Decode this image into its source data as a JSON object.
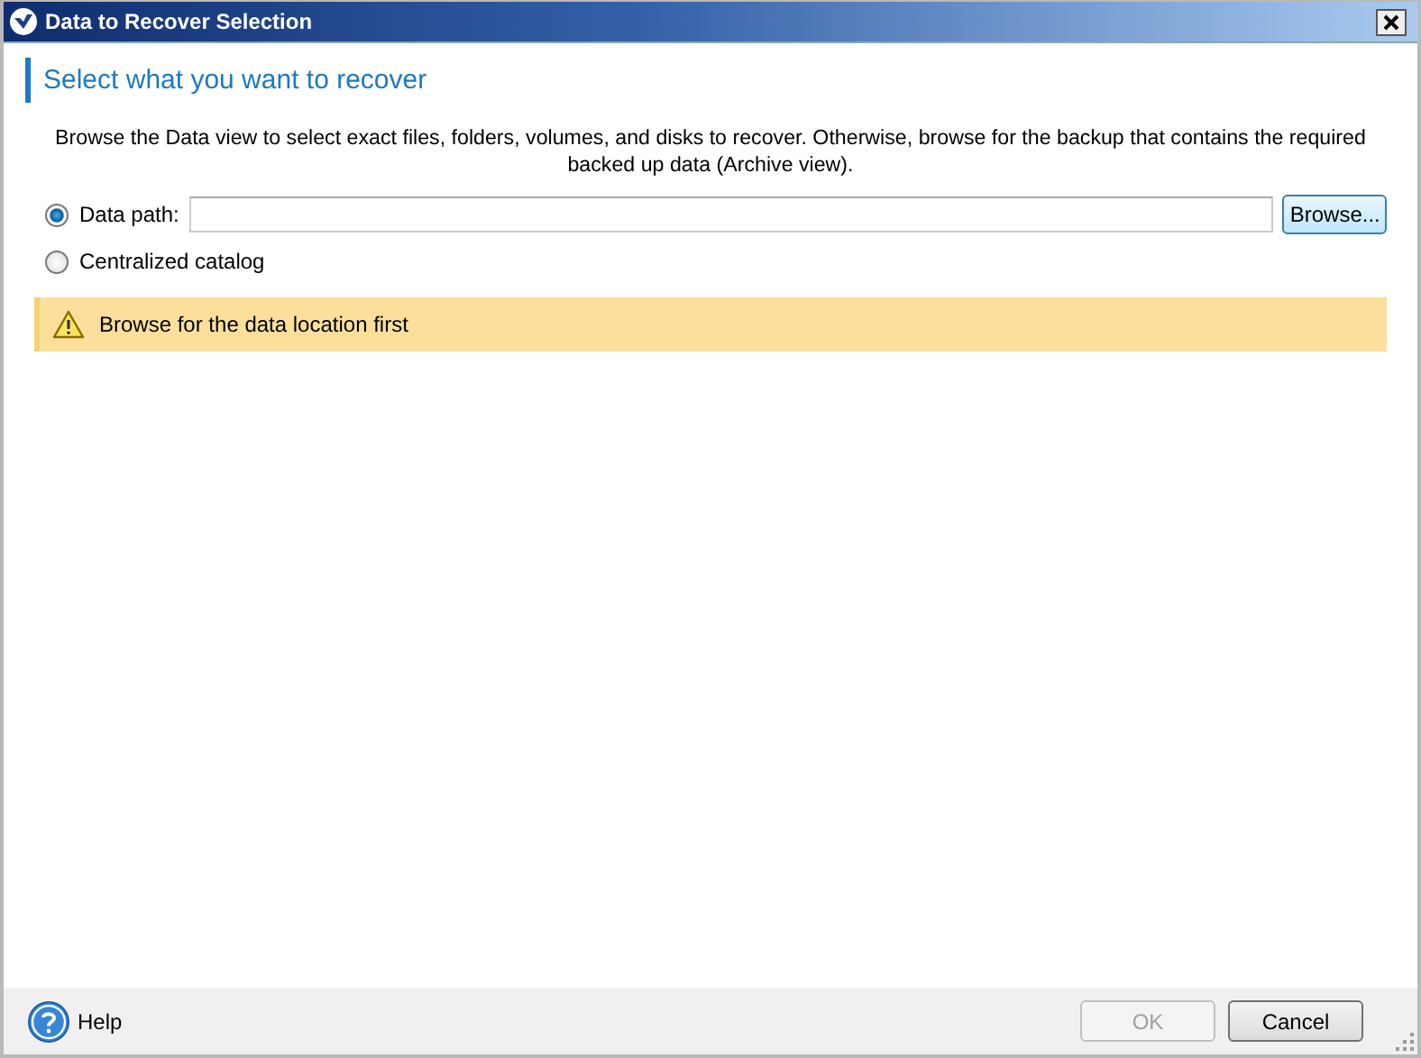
{
  "window": {
    "title": "Data to Recover Selection"
  },
  "heading": "Select what you want to recover",
  "description": "Browse the Data view to select exact files, folders, volumes, and disks to recover. Otherwise, browse for the backup that contains the required backed up data (Archive view).",
  "options": [
    {
      "label": "Data path:",
      "selected": true,
      "kind": "path"
    },
    {
      "label": "Centralized catalog",
      "selected": false,
      "kind": "plain"
    }
  ],
  "browse_button": "Browse...",
  "warning": "Browse for the data location first",
  "footer": {
    "help": "Help",
    "buttons": [
      {
        "label": "OK",
        "disabled": true
      },
      {
        "label": "Cancel",
        "disabled": false
      }
    ]
  }
}
